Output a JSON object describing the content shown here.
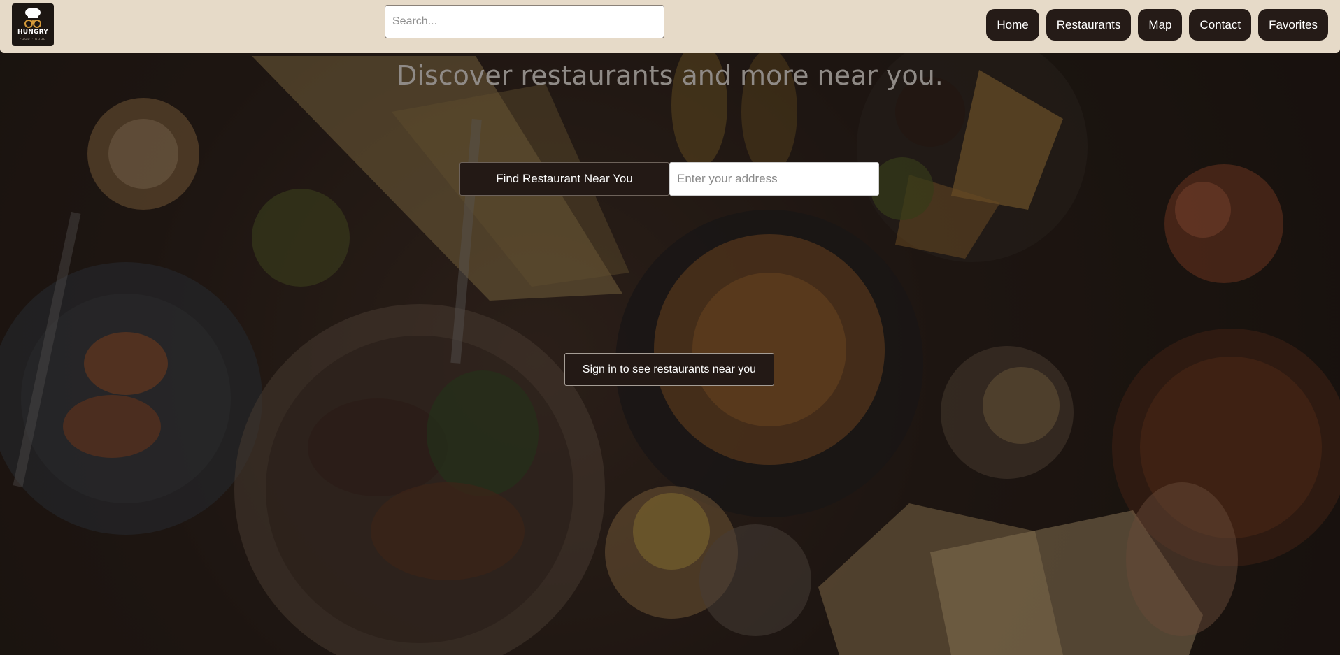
{
  "navbar": {
    "logo_text": "HUNGRY",
    "logo_subtext": "FOOD · GOOD",
    "search_placeholder": "Search...",
    "links": {
      "home": "Home",
      "restaurants": "Restaurants",
      "map": "Map",
      "contact": "Contact",
      "favorites": "Favorites"
    }
  },
  "hero": {
    "headline": "Discover restaurants and more near you.",
    "find_button": "Find Restaurant Near You",
    "address_placeholder": "Enter your address",
    "signin_button": "Sign in to see restaurants near you"
  },
  "colors": {
    "navbar_bg": "#e6dac8",
    "button_bg": "#251b17",
    "headline_text": "#8f8a86"
  }
}
